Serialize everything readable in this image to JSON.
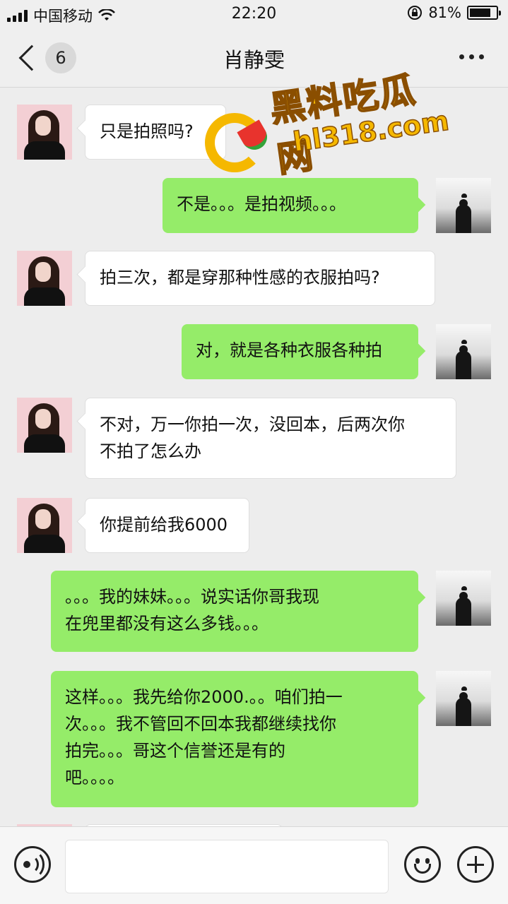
{
  "status_bar": {
    "carrier": "中国移动",
    "time": "22:20",
    "battery": "81%",
    "battery_level": 0.81,
    "icons": [
      "signal-icon",
      "wifi-icon",
      "orientation-lock-icon",
      "battery-icon"
    ]
  },
  "nav": {
    "unread_count": "6",
    "title": "肖静雯",
    "icons": [
      "back-icon",
      "more-icon"
    ]
  },
  "messages": [
    {
      "side": "left",
      "text": "只是拍照吗?"
    },
    {
      "side": "right",
      "text": "不是。。。是拍视频。。。"
    },
    {
      "side": "left",
      "text": "拍三次，都是穿那种性感的衣服拍吗?"
    },
    {
      "side": "right",
      "text": "对，就是各种衣服各种拍"
    },
    {
      "side": "left",
      "text": "不对，万一你拍一次，没回本，后两次你\n不拍了怎么办"
    },
    {
      "side": "left",
      "text": "你提前给我6000"
    },
    {
      "side": "right",
      "text": "。。。我的妹妹。。。说实话你哥我现\n在兜里都没有这么多钱。。。"
    },
    {
      "side": "right",
      "text": "这样。。。我先给你2000.。。咱们拍一\n次。。。我不管回不回本我都继续找你\n拍完。。。哥这个信誉还是有的\n吧。。。。"
    }
  ],
  "watermark": {
    "title": "黑料吃瓜网",
    "url": "hl318.com"
  },
  "input_bar": {
    "icons": [
      "voice-icon",
      "emoji-icon",
      "plus-icon"
    ]
  },
  "colors": {
    "background": "#ededed",
    "self_bubble": "#95ec69",
    "other_bubble": "#ffffff",
    "watermark": "#f5b800"
  }
}
